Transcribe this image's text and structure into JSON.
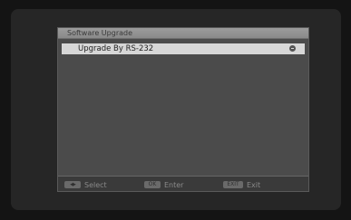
{
  "menu": {
    "title": "Software Upgrade",
    "items": [
      {
        "label": "Upgrade By RS-232",
        "selected": true
      }
    ]
  },
  "footer": {
    "select": {
      "key_icon": "up-down-arrows-icon",
      "key_label": "◀▶",
      "label": "Select"
    },
    "enter": {
      "key_label": "OK",
      "label": "Enter"
    },
    "exit": {
      "key_label": "EXIT",
      "label": "Exit"
    }
  },
  "colors": {
    "background": "#141414",
    "panel": "#4b4b4b",
    "title_bar": "#9c9c9c",
    "selected_item": "#d7d7d7",
    "footer": "#3a3a3a"
  }
}
